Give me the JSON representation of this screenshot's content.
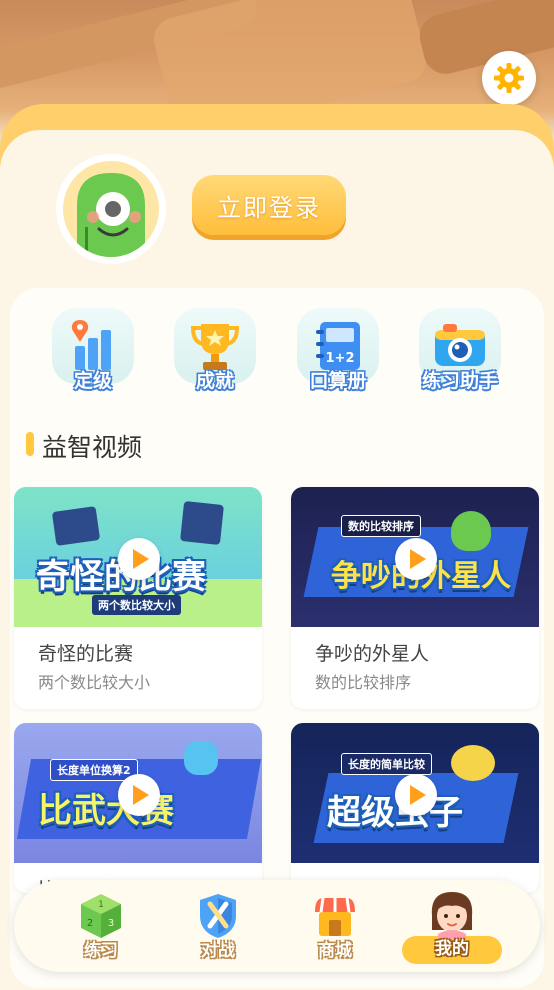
{
  "header": {
    "settings_icon": "gear-icon",
    "accent": "#ffc83d"
  },
  "profile": {
    "avatar_icon": "green-monster-avatar",
    "login_label": "立即登录"
  },
  "quick_actions": [
    {
      "label": "定级",
      "icon": "bar-chart-location-icon"
    },
    {
      "label": "成就",
      "icon": "trophy-icon"
    },
    {
      "label": "口算册",
      "icon": "notebook-icon"
    },
    {
      "label": "练习助手",
      "icon": "camera-icon"
    }
  ],
  "section": {
    "title": "益智视频"
  },
  "videos": [
    {
      "title": "奇怪的比赛",
      "subtitle": "两个数比较大小",
      "thumb_title": "奇怪的比赛",
      "thumb_tag": "两个数比较大小"
    },
    {
      "title": "争吵的外星人",
      "subtitle": "数的比较排序",
      "thumb_title": "争吵的外星人",
      "thumb_tag": "数的比较排序"
    },
    {
      "title": "比武大赛",
      "subtitle": "",
      "thumb_title": "比武大赛",
      "thumb_tag": "长度单位换算2"
    },
    {
      "title": "超级虫子",
      "subtitle": "",
      "thumb_title": "超级虫子",
      "thumb_tag": "长度的简单比较"
    }
  ],
  "tabbar": {
    "items": [
      {
        "label": "练习",
        "icon": "dice-cube-icon"
      },
      {
        "label": "对战",
        "icon": "sword-shield-icon"
      },
      {
        "label": "商城",
        "icon": "shop-icon"
      },
      {
        "label": "我的",
        "icon": "girl-avatar-icon"
      }
    ],
    "active_index": 3
  }
}
